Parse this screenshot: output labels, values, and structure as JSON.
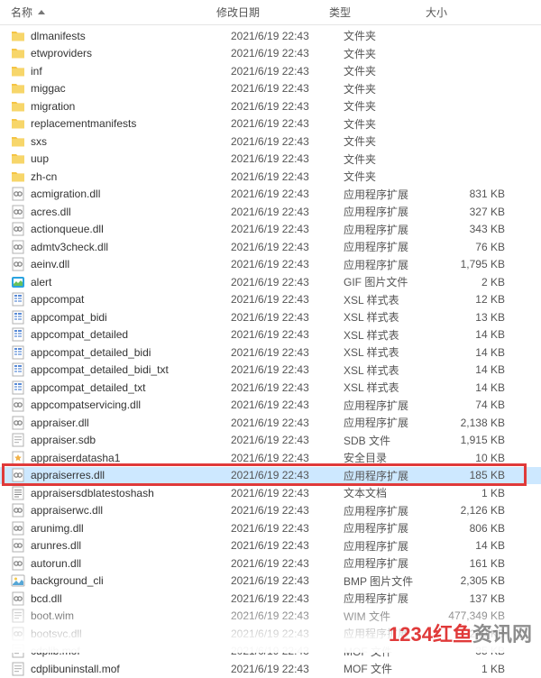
{
  "header": {
    "name": "名称",
    "date": "修改日期",
    "type": "类型",
    "size": "大小"
  },
  "watermark": {
    "red": "1234红鱼",
    "rest": "资讯网"
  },
  "rows": [
    {
      "icon": "folder",
      "name": "dlmanifests",
      "date": "2021/6/19 22:43",
      "type": "文件夹",
      "size": ""
    },
    {
      "icon": "folder",
      "name": "etwproviders",
      "date": "2021/6/19 22:43",
      "type": "文件夹",
      "size": ""
    },
    {
      "icon": "folder",
      "name": "inf",
      "date": "2021/6/19 22:43",
      "type": "文件夹",
      "size": ""
    },
    {
      "icon": "folder",
      "name": "miggac",
      "date": "2021/6/19 22:43",
      "type": "文件夹",
      "size": ""
    },
    {
      "icon": "folder",
      "name": "migration",
      "date": "2021/6/19 22:43",
      "type": "文件夹",
      "size": ""
    },
    {
      "icon": "folder",
      "name": "replacementmanifests",
      "date": "2021/6/19 22:43",
      "type": "文件夹",
      "size": ""
    },
    {
      "icon": "folder",
      "name": "sxs",
      "date": "2021/6/19 22:43",
      "type": "文件夹",
      "size": ""
    },
    {
      "icon": "folder",
      "name": "uup",
      "date": "2021/6/19 22:43",
      "type": "文件夹",
      "size": ""
    },
    {
      "icon": "folder",
      "name": "zh-cn",
      "date": "2021/6/19 22:43",
      "type": "文件夹",
      "size": ""
    },
    {
      "icon": "dll",
      "name": "acmigration.dll",
      "date": "2021/6/19 22:43",
      "type": "应用程序扩展",
      "size": "831 KB"
    },
    {
      "icon": "dll",
      "name": "acres.dll",
      "date": "2021/6/19 22:43",
      "type": "应用程序扩展",
      "size": "327 KB"
    },
    {
      "icon": "dll",
      "name": "actionqueue.dll",
      "date": "2021/6/19 22:43",
      "type": "应用程序扩展",
      "size": "343 KB"
    },
    {
      "icon": "dll",
      "name": "admtv3check.dll",
      "date": "2021/6/19 22:43",
      "type": "应用程序扩展",
      "size": "76 KB"
    },
    {
      "icon": "dll",
      "name": "aeinv.dll",
      "date": "2021/6/19 22:43",
      "type": "应用程序扩展",
      "size": "1,795 KB"
    },
    {
      "icon": "gif",
      "name": "alert",
      "date": "2021/6/19 22:43",
      "type": "GIF 图片文件",
      "size": "2 KB"
    },
    {
      "icon": "xsl",
      "name": "appcompat",
      "date": "2021/6/19 22:43",
      "type": "XSL 样式表",
      "size": "12 KB"
    },
    {
      "icon": "xsl",
      "name": "appcompat_bidi",
      "date": "2021/6/19 22:43",
      "type": "XSL 样式表",
      "size": "13 KB"
    },
    {
      "icon": "xsl",
      "name": "appcompat_detailed",
      "date": "2021/6/19 22:43",
      "type": "XSL 样式表",
      "size": "14 KB"
    },
    {
      "icon": "xsl",
      "name": "appcompat_detailed_bidi",
      "date": "2021/6/19 22:43",
      "type": "XSL 样式表",
      "size": "14 KB"
    },
    {
      "icon": "xsl",
      "name": "appcompat_detailed_bidi_txt",
      "date": "2021/6/19 22:43",
      "type": "XSL 样式表",
      "size": "14 KB"
    },
    {
      "icon": "xsl",
      "name": "appcompat_detailed_txt",
      "date": "2021/6/19 22:43",
      "type": "XSL 样式表",
      "size": "14 KB"
    },
    {
      "icon": "dll",
      "name": "appcompatservicing.dll",
      "date": "2021/6/19 22:43",
      "type": "应用程序扩展",
      "size": "74 KB"
    },
    {
      "icon": "dll",
      "name": "appraiser.dll",
      "date": "2021/6/19 22:43",
      "type": "应用程序扩展",
      "size": "2,138 KB"
    },
    {
      "icon": "sdb",
      "name": "appraiser.sdb",
      "date": "2021/6/19 22:43",
      "type": "SDB 文件",
      "size": "1,915 KB"
    },
    {
      "icon": "cat",
      "name": "appraiserdatasha1",
      "date": "2021/6/19 22:43",
      "type": "安全目录",
      "size": "10 KB"
    },
    {
      "icon": "dll",
      "name": "appraiserres.dll",
      "date": "2021/6/19 22:43",
      "type": "应用程序扩展",
      "size": "185 KB",
      "selected": true
    },
    {
      "icon": "txt",
      "name": "appraisersdblatestoshash",
      "date": "2021/6/19 22:43",
      "type": "文本文档",
      "size": "1 KB"
    },
    {
      "icon": "dll",
      "name": "appraiserwc.dll",
      "date": "2021/6/19 22:43",
      "type": "应用程序扩展",
      "size": "2,126 KB"
    },
    {
      "icon": "dll",
      "name": "arunimg.dll",
      "date": "2021/6/19 22:43",
      "type": "应用程序扩展",
      "size": "806 KB"
    },
    {
      "icon": "dll",
      "name": "arunres.dll",
      "date": "2021/6/19 22:43",
      "type": "应用程序扩展",
      "size": "14 KB"
    },
    {
      "icon": "dll",
      "name": "autorun.dll",
      "date": "2021/6/19 22:43",
      "type": "应用程序扩展",
      "size": "161 KB"
    },
    {
      "icon": "bmp",
      "name": "background_cli",
      "date": "2021/6/19 22:43",
      "type": "BMP 图片文件",
      "size": "2,305 KB"
    },
    {
      "icon": "dll",
      "name": "bcd.dll",
      "date": "2021/6/19 22:43",
      "type": "应用程序扩展",
      "size": "137 KB"
    },
    {
      "icon": "wim",
      "name": "boot.wim",
      "date": "2021/6/19 22:43",
      "type": "WIM 文件",
      "size": "477,349 KB"
    },
    {
      "icon": "dll",
      "name": "bootsvc.dll",
      "date": "2021/6/19 22:43",
      "type": "应用程序扩展",
      "size": "249 KB"
    },
    {
      "icon": "mof",
      "name": "cdplib.mof",
      "date": "2021/6/19 22:43",
      "type": "MOF 文件",
      "size": "35 KB"
    },
    {
      "icon": "mof",
      "name": "cdplibuninstall.mof",
      "date": "2021/6/19 22:43",
      "type": "MOF 文件",
      "size": "1 KB"
    }
  ]
}
